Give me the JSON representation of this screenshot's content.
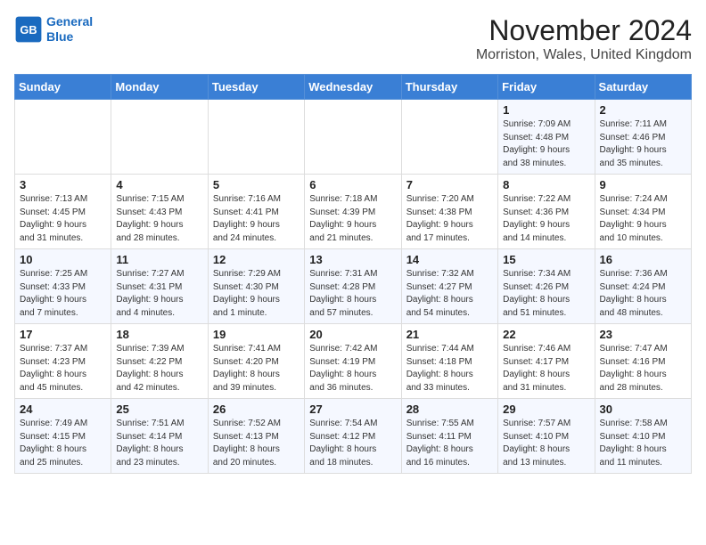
{
  "header": {
    "logo_line1": "General",
    "logo_line2": "Blue",
    "month": "November 2024",
    "location": "Morriston, Wales, United Kingdom"
  },
  "weekdays": [
    "Sunday",
    "Monday",
    "Tuesday",
    "Wednesday",
    "Thursday",
    "Friday",
    "Saturday"
  ],
  "weeks": [
    [
      {
        "day": "",
        "info": ""
      },
      {
        "day": "",
        "info": ""
      },
      {
        "day": "",
        "info": ""
      },
      {
        "day": "",
        "info": ""
      },
      {
        "day": "",
        "info": ""
      },
      {
        "day": "1",
        "info": "Sunrise: 7:09 AM\nSunset: 4:48 PM\nDaylight: 9 hours\nand 38 minutes."
      },
      {
        "day": "2",
        "info": "Sunrise: 7:11 AM\nSunset: 4:46 PM\nDaylight: 9 hours\nand 35 minutes."
      }
    ],
    [
      {
        "day": "3",
        "info": "Sunrise: 7:13 AM\nSunset: 4:45 PM\nDaylight: 9 hours\nand 31 minutes."
      },
      {
        "day": "4",
        "info": "Sunrise: 7:15 AM\nSunset: 4:43 PM\nDaylight: 9 hours\nand 28 minutes."
      },
      {
        "day": "5",
        "info": "Sunrise: 7:16 AM\nSunset: 4:41 PM\nDaylight: 9 hours\nand 24 minutes."
      },
      {
        "day": "6",
        "info": "Sunrise: 7:18 AM\nSunset: 4:39 PM\nDaylight: 9 hours\nand 21 minutes."
      },
      {
        "day": "7",
        "info": "Sunrise: 7:20 AM\nSunset: 4:38 PM\nDaylight: 9 hours\nand 17 minutes."
      },
      {
        "day": "8",
        "info": "Sunrise: 7:22 AM\nSunset: 4:36 PM\nDaylight: 9 hours\nand 14 minutes."
      },
      {
        "day": "9",
        "info": "Sunrise: 7:24 AM\nSunset: 4:34 PM\nDaylight: 9 hours\nand 10 minutes."
      }
    ],
    [
      {
        "day": "10",
        "info": "Sunrise: 7:25 AM\nSunset: 4:33 PM\nDaylight: 9 hours\nand 7 minutes."
      },
      {
        "day": "11",
        "info": "Sunrise: 7:27 AM\nSunset: 4:31 PM\nDaylight: 9 hours\nand 4 minutes."
      },
      {
        "day": "12",
        "info": "Sunrise: 7:29 AM\nSunset: 4:30 PM\nDaylight: 9 hours\nand 1 minute."
      },
      {
        "day": "13",
        "info": "Sunrise: 7:31 AM\nSunset: 4:28 PM\nDaylight: 8 hours\nand 57 minutes."
      },
      {
        "day": "14",
        "info": "Sunrise: 7:32 AM\nSunset: 4:27 PM\nDaylight: 8 hours\nand 54 minutes."
      },
      {
        "day": "15",
        "info": "Sunrise: 7:34 AM\nSunset: 4:26 PM\nDaylight: 8 hours\nand 51 minutes."
      },
      {
        "day": "16",
        "info": "Sunrise: 7:36 AM\nSunset: 4:24 PM\nDaylight: 8 hours\nand 48 minutes."
      }
    ],
    [
      {
        "day": "17",
        "info": "Sunrise: 7:37 AM\nSunset: 4:23 PM\nDaylight: 8 hours\nand 45 minutes."
      },
      {
        "day": "18",
        "info": "Sunrise: 7:39 AM\nSunset: 4:22 PM\nDaylight: 8 hours\nand 42 minutes."
      },
      {
        "day": "19",
        "info": "Sunrise: 7:41 AM\nSunset: 4:20 PM\nDaylight: 8 hours\nand 39 minutes."
      },
      {
        "day": "20",
        "info": "Sunrise: 7:42 AM\nSunset: 4:19 PM\nDaylight: 8 hours\nand 36 minutes."
      },
      {
        "day": "21",
        "info": "Sunrise: 7:44 AM\nSunset: 4:18 PM\nDaylight: 8 hours\nand 33 minutes."
      },
      {
        "day": "22",
        "info": "Sunrise: 7:46 AM\nSunset: 4:17 PM\nDaylight: 8 hours\nand 31 minutes."
      },
      {
        "day": "23",
        "info": "Sunrise: 7:47 AM\nSunset: 4:16 PM\nDaylight: 8 hours\nand 28 minutes."
      }
    ],
    [
      {
        "day": "24",
        "info": "Sunrise: 7:49 AM\nSunset: 4:15 PM\nDaylight: 8 hours\nand 25 minutes."
      },
      {
        "day": "25",
        "info": "Sunrise: 7:51 AM\nSunset: 4:14 PM\nDaylight: 8 hours\nand 23 minutes."
      },
      {
        "day": "26",
        "info": "Sunrise: 7:52 AM\nSunset: 4:13 PM\nDaylight: 8 hours\nand 20 minutes."
      },
      {
        "day": "27",
        "info": "Sunrise: 7:54 AM\nSunset: 4:12 PM\nDaylight: 8 hours\nand 18 minutes."
      },
      {
        "day": "28",
        "info": "Sunrise: 7:55 AM\nSunset: 4:11 PM\nDaylight: 8 hours\nand 16 minutes."
      },
      {
        "day": "29",
        "info": "Sunrise: 7:57 AM\nSunset: 4:10 PM\nDaylight: 8 hours\nand 13 minutes."
      },
      {
        "day": "30",
        "info": "Sunrise: 7:58 AM\nSunset: 4:10 PM\nDaylight: 8 hours\nand 11 minutes."
      }
    ]
  ]
}
